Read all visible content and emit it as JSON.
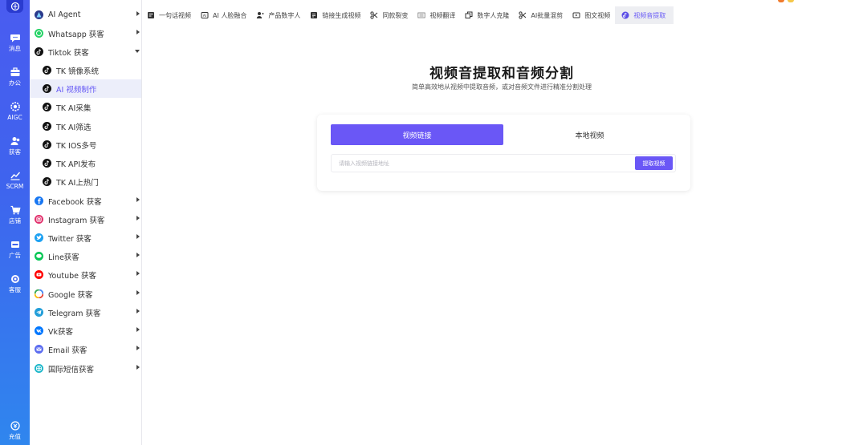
{
  "rail": {
    "items": [
      {
        "label": "消息",
        "icon": "chat-icon"
      },
      {
        "label": "办公",
        "icon": "briefcase-icon"
      },
      {
        "label": "AIGC",
        "icon": "aigc-icon"
      },
      {
        "label": "获客",
        "icon": "users-icon"
      },
      {
        "label": "SCRM",
        "icon": "chart-icon"
      },
      {
        "label": "店铺",
        "icon": "cart-icon"
      },
      {
        "label": "广告",
        "icon": "ads-icon"
      },
      {
        "label": "客服",
        "icon": "support-icon"
      }
    ],
    "bottom": {
      "label": "充值",
      "icon": "recharge-icon"
    }
  },
  "menu": {
    "items": [
      {
        "label": "AI Agent",
        "icon": "ai-agent-icon",
        "color": "#2b3a8c"
      },
      {
        "label": "Whatsapp 获客",
        "icon": "whatsapp-icon",
        "color": "#25d366"
      },
      {
        "label": "Tiktok 获客",
        "icon": "tiktok-icon",
        "color": "#111111"
      },
      {
        "label": "TK 镜像系统",
        "icon": "tiktok-icon",
        "color": "#111111"
      },
      {
        "label": "AI 视频制作",
        "icon": "tiktok-icon",
        "color": "#111111"
      },
      {
        "label": "TK AI采集",
        "icon": "tiktok-icon",
        "color": "#111111"
      },
      {
        "label": "TK AI筛选",
        "icon": "tiktok-icon",
        "color": "#111111"
      },
      {
        "label": "TK IOS多号",
        "icon": "tiktok-icon",
        "color": "#111111"
      },
      {
        "label": "TK API发布",
        "icon": "tiktok-icon",
        "color": "#111111"
      },
      {
        "label": "TK AI上热门",
        "icon": "tiktok-icon",
        "color": "#111111"
      },
      {
        "label": "Facebook 获客",
        "icon": "facebook-icon",
        "color": "#1877f2"
      },
      {
        "label": "Instagram 获客",
        "icon": "instagram-icon",
        "color": "#e1306c"
      },
      {
        "label": "Twitter 获客",
        "icon": "twitter-icon",
        "color": "#1da1f2"
      },
      {
        "label": "Line获客",
        "icon": "line-icon",
        "color": "#06c755"
      },
      {
        "label": "Youtube 获客",
        "icon": "youtube-icon",
        "color": "#ff0000"
      },
      {
        "label": "Google 获客",
        "icon": "google-icon",
        "color": "#4285f4"
      },
      {
        "label": "Telegram 获客",
        "icon": "telegram-icon",
        "color": "#229ed9"
      },
      {
        "label": "Vk获客",
        "icon": "vk-icon",
        "color": "#0077ff"
      },
      {
        "label": "Email 获客",
        "icon": "email-icon",
        "color": "#5b6cf0"
      },
      {
        "label": "国际短信获客",
        "icon": "sms-icon",
        "color": "#19b6c9"
      }
    ]
  },
  "tabs": [
    {
      "label": "一句话视频",
      "icon": "video-doc-icon"
    },
    {
      "label": "AI 人脸融合",
      "icon": "face-icon"
    },
    {
      "label": "产品数字人",
      "icon": "digital-person-icon"
    },
    {
      "label": "链接生成视频",
      "icon": "link-video-icon"
    },
    {
      "label": "同款裂变",
      "icon": "scissors-icon"
    },
    {
      "label": "视频翻译",
      "icon": "translate-icon"
    },
    {
      "label": "数字人克隆",
      "icon": "clone-icon"
    },
    {
      "label": "AI批量混剪",
      "icon": "scissors-icon"
    },
    {
      "label": "图文视频",
      "icon": "image-video-icon"
    },
    {
      "label": "视频音提取",
      "icon": "audio-extract-icon"
    }
  ],
  "main": {
    "title": "视频音提取和音频分割",
    "subtitle": "简单高效地从视频中提取音频，或对音频文件进行精准分割处理",
    "segments": {
      "link": "视频链接",
      "local": "本地视频"
    },
    "url_input": {
      "placeholder": "请输入视频链接地址",
      "value": ""
    },
    "extract_button": "提取视频"
  },
  "colors": {
    "accent": "#6a57f6",
    "rail_top": "#4a5cf0",
    "rail_bottom": "#2f86ee"
  }
}
